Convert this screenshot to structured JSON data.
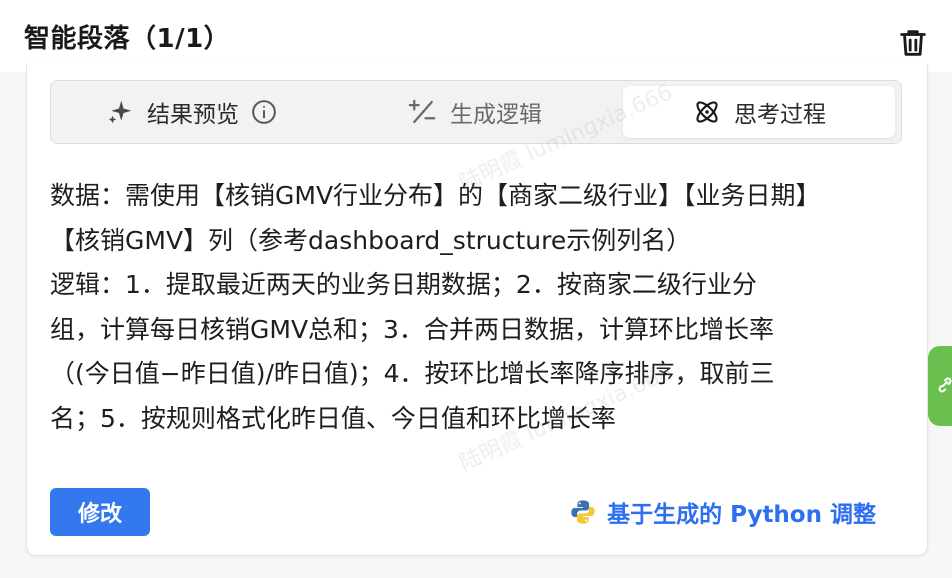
{
  "header": {
    "title": "智能段落（1/1）"
  },
  "tabs": [
    {
      "label": "结果预览",
      "icon": "sparkle-icon"
    },
    {
      "label": "生成逻辑",
      "icon": "plus-minus-icon"
    },
    {
      "label": "思考过程",
      "icon": "atom-icon"
    }
  ],
  "active_tab": "思考过程",
  "content": {
    "lines": [
      "数据：需使用【核销GMV行业分布】的【商家二级行业】【业务日期】",
      "【核销GMV】列（参考dashboard_structure示例列名）",
      "逻辑：1．提取最近两天的业务日期数据；2．按商家二级行业分",
      "组，计算每日核销GMV总和；3．合并两日数据，计算环比增长率",
      "（(今日值−昨日值)/昨日值)；4．按环比增长率降序排序，取前三",
      "名；5．按规则格式化昨日值、今日值和环比增长率"
    ]
  },
  "actions": {
    "modify_label": "修改",
    "python_adjust_label": "基于生成的 Python 调整"
  },
  "watermark": {
    "text": "陆明霞 lumingxia.666"
  },
  "colors": {
    "primary": "#3478f0",
    "link": "#2e6ef0",
    "side_tab": "#6bbf4e"
  }
}
